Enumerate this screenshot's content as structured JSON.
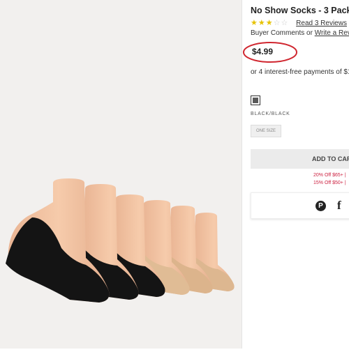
{
  "product": {
    "title": "No Show Socks - 3 Pack",
    "rating": {
      "filled": 3,
      "total": 5
    },
    "reviews_link": "Read 3 Reviews",
    "comments_prefix": "Buyer Comments or ",
    "comments_link": "Write a Revi",
    "price": "$4.99",
    "installments": "or 4 interest-free payments of $1",
    "color_label": "BLACK/BLACK",
    "size_label": "ONE SIZE",
    "add_to_cart": "ADD TO CAR",
    "promos": [
      "20% Off $65+ |",
      "15% Off $50+ |"
    ]
  },
  "share": {
    "pinterest_glyph": "P",
    "facebook_glyph": "f"
  },
  "icons": [
    "pinterest-icon",
    "facebook-icon",
    "star-icon"
  ],
  "colors": {
    "price_circle": "#d0262f",
    "star_filled": "#e6c200",
    "star_empty": "#cccccc",
    "promo_red": "#cc1f3f",
    "sock_black": "#141414",
    "sock_nude": "#e0bc95",
    "skin": "#f0c0a0"
  }
}
